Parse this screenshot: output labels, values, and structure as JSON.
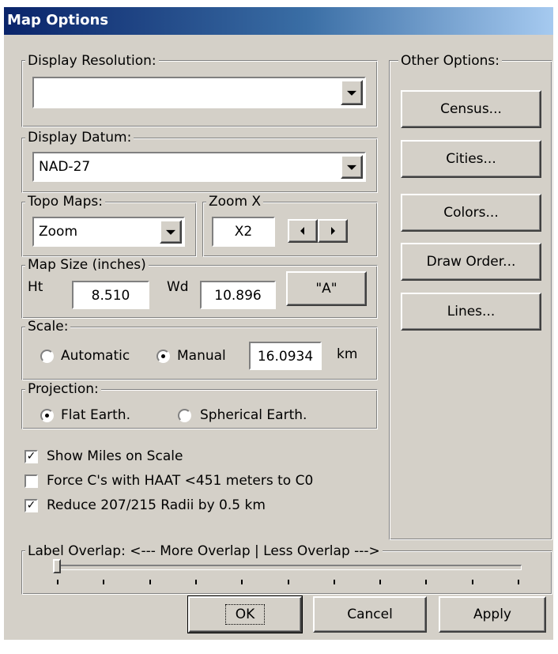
{
  "window": {
    "title": "Map Options"
  },
  "display_resolution": {
    "legend": "Display Resolution:",
    "value": ""
  },
  "display_datum": {
    "legend": "Display Datum:",
    "value": "NAD-27"
  },
  "topo_maps": {
    "legend": "Topo Maps:",
    "value": "Zoom"
  },
  "zoom_x": {
    "legend": "Zoom X",
    "value": "X2"
  },
  "map_size": {
    "legend": "Map Size (inches)",
    "ht_label": "Ht",
    "ht_value": "8.510",
    "wd_label": "Wd",
    "wd_value": "10.896",
    "a_button": "\"A\""
  },
  "scale": {
    "legend": "Scale:",
    "automatic_label": "Automatic",
    "manual_label": "Manual",
    "selected": "Manual",
    "value": "16.0934",
    "unit": "km"
  },
  "projection": {
    "legend": "Projection:",
    "flat_label": "Flat Earth.",
    "spherical_label": "Spherical Earth.",
    "selected": "Flat Earth."
  },
  "checkboxes": [
    {
      "label": "Show Miles on Scale",
      "checked": true
    },
    {
      "label": "Force C's with HAAT <451 meters to C0",
      "checked": false
    },
    {
      "label": "Reduce 207/215 Radii by 0.5 km",
      "checked": true
    }
  ],
  "other_options": {
    "legend": "Other Options:",
    "buttons": [
      "Census...",
      "Cities...",
      "Colors...",
      "Draw Order...",
      "Lines..."
    ]
  },
  "label_overlap": {
    "legend": "Label Overlap:  <--- More Overlap | Less Overlap --->",
    "slider_value": 0,
    "slider_max": 10
  },
  "footer": {
    "ok": "OK",
    "cancel": "Cancel",
    "apply": "Apply"
  },
  "colors": {
    "title_start": "#0a246a",
    "title_end": "#a6caf0",
    "face": "#d4d0c8"
  },
  "icons": [
    "dropdown-arrow-icon",
    "arrow-left-icon",
    "arrow-right-icon",
    "checkmark-icon"
  ]
}
